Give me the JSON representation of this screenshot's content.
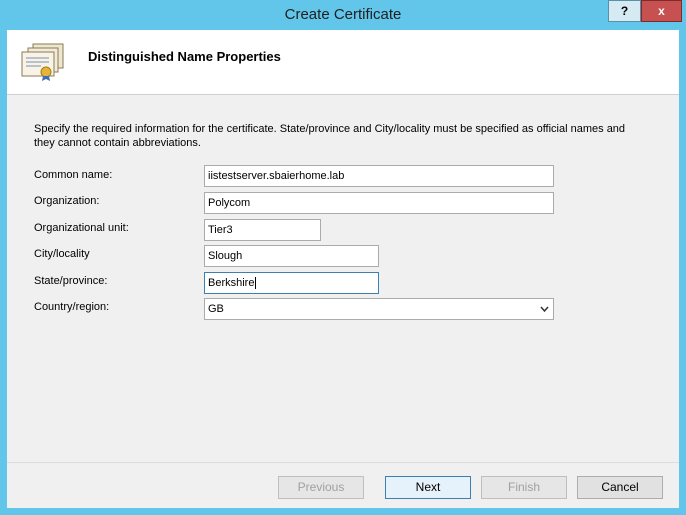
{
  "window": {
    "title": "Create Certificate"
  },
  "titlebar": {
    "help_label": "?",
    "close_label": "x"
  },
  "header": {
    "title": "Distinguished Name Properties"
  },
  "description": "Specify the required information for the certificate. State/province and City/locality must be specified as official names and they cannot contain abbreviations.",
  "form": {
    "common_name": {
      "label": "Common name:",
      "value": "iistestserver.sbaierhome.lab"
    },
    "organization": {
      "label": "Organization:",
      "value": "Polycom"
    },
    "organizational_unit": {
      "label": "Organizational unit:",
      "value": "Tier3"
    },
    "city": {
      "label": "City/locality",
      "value": "Slough"
    },
    "state": {
      "label": "State/province:",
      "value": "Berkshire"
    },
    "country": {
      "label": "Country/region:",
      "value": "GB"
    }
  },
  "buttons": {
    "previous": "Previous",
    "next": "Next",
    "finish": "Finish",
    "cancel": "Cancel"
  },
  "icons": {
    "help": "help-icon",
    "close": "close-icon",
    "certificate": "certificate-icon",
    "dropdown": "chevron-down-icon"
  },
  "colors": {
    "titlebar": "#62c6ea",
    "close_button": "#c75050",
    "focus": "#3c7fb1"
  }
}
